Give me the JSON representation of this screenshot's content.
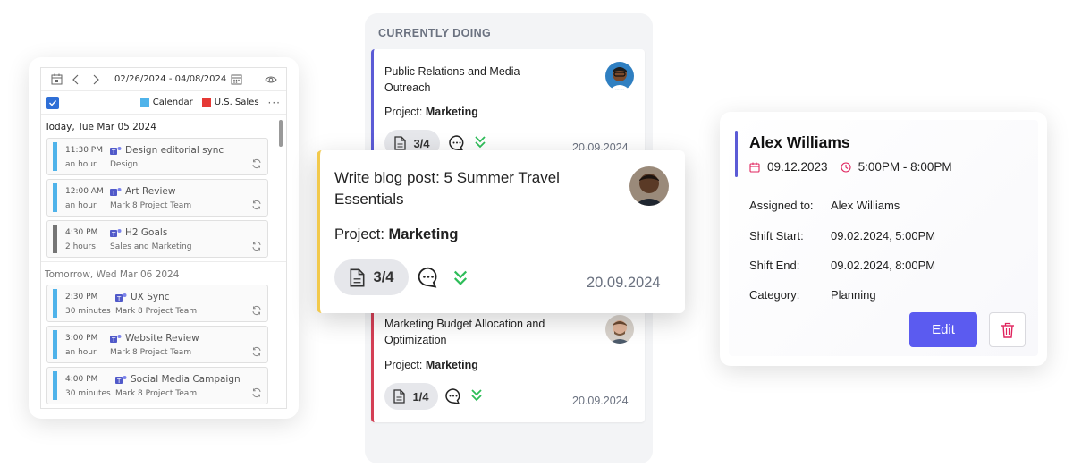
{
  "calendar": {
    "date_range": "02/26/2024 - 04/08/2024",
    "legend": [
      {
        "label": "Calendar",
        "color": "#4fb3ea"
      },
      {
        "label": "U.S. Sales",
        "color": "#e53935"
      }
    ],
    "more": "···",
    "today_header": "Today, Tue Mar 05 2024",
    "tomorrow_header": "Tomorrow, Wed Mar 06 2024",
    "today_events": [
      {
        "time": "11:30 PM",
        "duration": "an hour",
        "title": "Design editorial sync",
        "organizer": "Design",
        "color": "#4fb3ea"
      },
      {
        "time": "12:00 AM",
        "duration": "an hour",
        "title": "Art Review",
        "organizer": "Mark 8 Project Team",
        "color": "#4fb3ea"
      },
      {
        "time": "4:30 PM",
        "duration": "2 hours",
        "title": "H2 Goals",
        "organizer": "Sales and Marketing",
        "color": "#757575"
      }
    ],
    "tomorrow_events": [
      {
        "time": "2:30 PM",
        "duration": "30 minutes",
        "title": "UX Sync",
        "organizer": "Mark 8 Project Team",
        "color": "#4fb3ea"
      },
      {
        "time": "3:00 PM",
        "duration": "an hour",
        "title": "Website Review",
        "organizer": "Mark 8 Project Team",
        "color": "#4fb3ea"
      },
      {
        "time": "4:00 PM",
        "duration": "30 minutes",
        "title": "Social Media Campaign",
        "organizer": "Mark 8 Project Team",
        "color": "#4fb3ea"
      }
    ]
  },
  "kanban": {
    "column_title": "CURRENTLY DOING",
    "cards": [
      {
        "title_line1": "Public Relations and Media",
        "title_line2": "Outreach",
        "project_label": "Project:",
        "project": "Marketing",
        "progress": "3/4",
        "date": "20.09.2024",
        "accent": "#5b5bd6"
      },
      {
        "title_line1": "Write blog post: 5 Summer Travel",
        "title_line2": "Essentials",
        "project_label": "Project:",
        "project": "Marketing",
        "progress": "3/4",
        "date": "20.09.2024",
        "accent": "#f2c94c"
      },
      {
        "title_line1": "Marketing Budget Allocation and",
        "title_line2": "Optimization",
        "project_label": "Project:",
        "project": "Marketing",
        "progress": "1/4",
        "date": "20.09.2024",
        "accent": "#d43f55"
      }
    ]
  },
  "shift": {
    "name": "Alex Williams",
    "date": "09.12.2023",
    "time": "5:00PM - 8:00PM",
    "rows": [
      {
        "label": "Assigned to:",
        "value": "Alex Williams"
      },
      {
        "label": "Shift Start:",
        "value": "09.02.2024, 5:00PM"
      },
      {
        "label": "Shift End:",
        "value": "09.02.2024, 8:00PM"
      },
      {
        "label": "Category:",
        "value": "Planning"
      }
    ],
    "edit_label": "Edit",
    "accent": "#5b5bf0"
  }
}
